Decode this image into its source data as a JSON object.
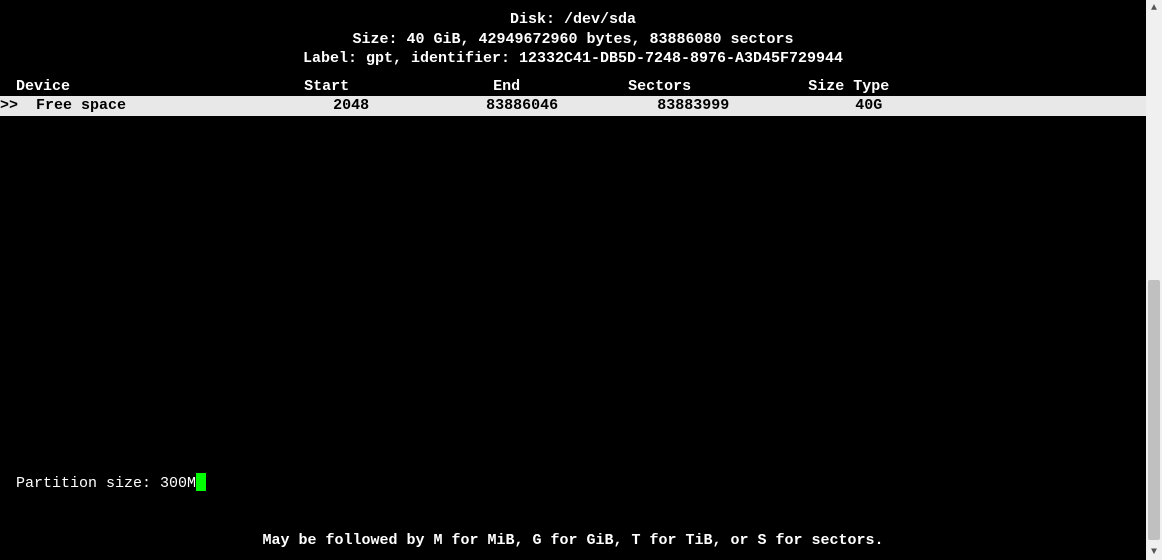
{
  "header": {
    "title": "Disk: /dev/sda",
    "size_line": "Size: 40 GiB, 42949672960 bytes, 83886080 sectors",
    "label_line": "Label: gpt, identifier: 12332C41-DB5D-7248-8976-A3D45F729944"
  },
  "table": {
    "columns": {
      "device": "Device",
      "start": "Start",
      "end": "End",
      "sectors": "Sectors",
      "size": "Size",
      "type": "Type"
    },
    "rows": [
      {
        "indicator": ">>",
        "device": "Free space",
        "start": "2048",
        "end": "83886046",
        "sectors": "83883999",
        "size": "40G",
        "type": ""
      }
    ]
  },
  "prompt": {
    "label": "Partition size: ",
    "value": "300M"
  },
  "hint": "May be followed by M for MiB, G for GiB, T for TiB, or S for sectors."
}
